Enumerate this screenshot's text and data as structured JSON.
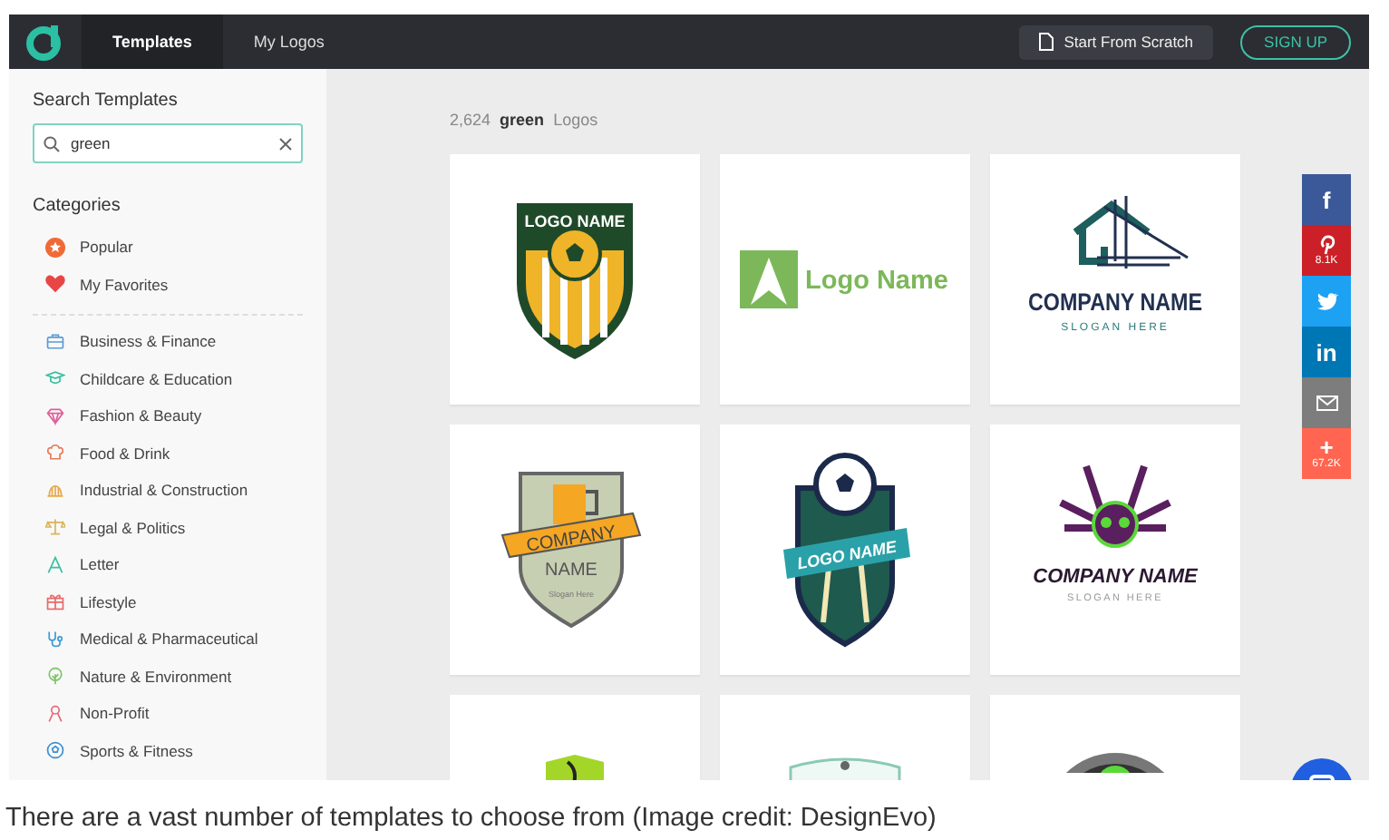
{
  "nav": {
    "tabs": [
      {
        "label": "Templates",
        "selected": true
      },
      {
        "label": "My Logos",
        "selected": false
      }
    ],
    "scratch_button": "Start From Scratch",
    "signup_button": "SIGN UP"
  },
  "sidebar": {
    "search_heading": "Search Templates",
    "search": {
      "value": "green"
    },
    "categories_heading": "Categories",
    "pinned": [
      {
        "label": "Popular",
        "color": "#f06a35"
      },
      {
        "label": "My Favorites",
        "color": "#e84545"
      }
    ],
    "categories": [
      {
        "label": "Business & Finance",
        "color": "#5b9bd5"
      },
      {
        "label": "Childcare & Education",
        "color": "#3bbf9f"
      },
      {
        "label": "Fashion & Beauty",
        "color": "#e0609a"
      },
      {
        "label": "Food & Drink",
        "color": "#e8785a"
      },
      {
        "label": "Industrial & Construction",
        "color": "#e8a84a"
      },
      {
        "label": "Legal & Politics",
        "color": "#d9b45a"
      },
      {
        "label": "Letter",
        "color": "#3bbf9f"
      },
      {
        "label": "Lifestyle",
        "color": "#e86a6a"
      },
      {
        "label": "Medical & Pharmaceutical",
        "color": "#3a9bd5"
      },
      {
        "label": "Nature & Environment",
        "color": "#7cc46a"
      },
      {
        "label": "Non-Profit",
        "color": "#e86a7a"
      },
      {
        "label": "Sports & Fitness",
        "color": "#3a8fd5"
      }
    ]
  },
  "results": {
    "count": "2,624",
    "query": "green",
    "suffix": "Logos"
  },
  "templates": [
    {
      "kind": "soccer-crest",
      "name": "LOGO NAME"
    },
    {
      "kind": "letter-mark",
      "name": "Logo Name"
    },
    {
      "kind": "house-lines",
      "name": "COMPANY NAME",
      "slogan": "SLOGAN HERE"
    },
    {
      "kind": "beer-shield",
      "name": "COMPANY",
      "name_2": "NAME",
      "slogan": "Slogan Here"
    },
    {
      "kind": "soccer-banner",
      "name": "LOGO NAME"
    },
    {
      "kind": "skull-guns",
      "name": "COMPANY NAME",
      "slogan": "SLOGAN HERE"
    },
    {
      "kind": "lime-crest"
    },
    {
      "kind": "mint-shield"
    },
    {
      "kind": "sunburst-badge"
    }
  ],
  "share": [
    {
      "kind": "facebook",
      "glyph": "f"
    },
    {
      "kind": "pinterest",
      "count": "8.1K"
    },
    {
      "kind": "twitter"
    },
    {
      "kind": "linkedin",
      "glyph": "in"
    },
    {
      "kind": "email"
    },
    {
      "kind": "more",
      "glyph": "+",
      "count": "67.2K"
    }
  ],
  "caption": "There are a vast number of templates to choose from (Image credit: DesignEvo)"
}
